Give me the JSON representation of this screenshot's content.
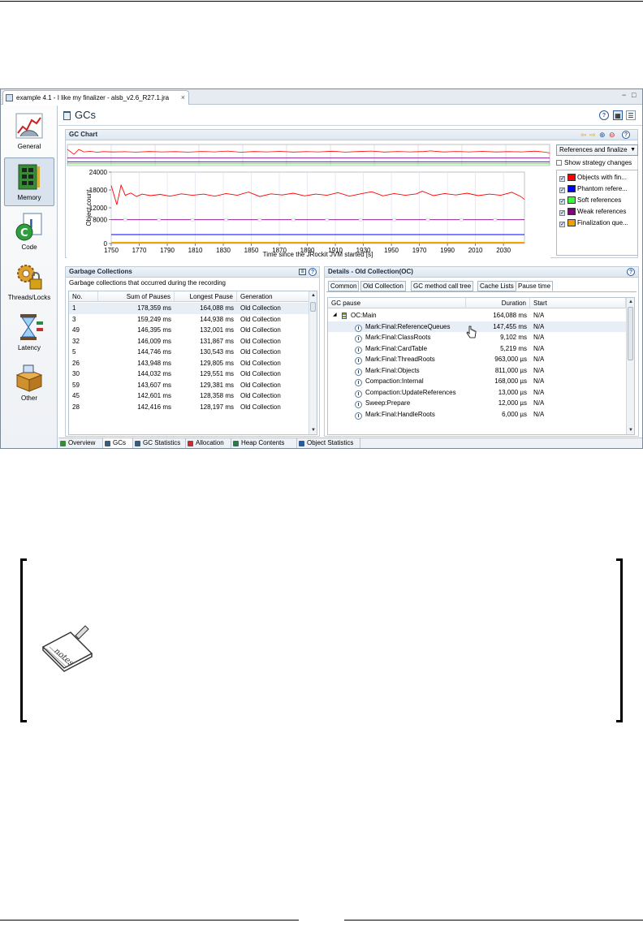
{
  "window": {
    "tab_title": "example 4.1 - I like my finalizer - alsb_v2.6_R27.1.jra",
    "close_glyph": "×",
    "minimize_glyph": "−",
    "maximize_glyph": "□"
  },
  "nav": {
    "items": [
      {
        "label": "General"
      },
      {
        "label": "Memory"
      },
      {
        "label": "Code"
      },
      {
        "label": "Threads/Locks"
      },
      {
        "label": "Latency"
      },
      {
        "label": "Other"
      }
    ],
    "active": "Memory"
  },
  "page": {
    "title": "GCs"
  },
  "gc_chart": {
    "header": "GC Chart",
    "dropdown_value": "References and finalize",
    "show_strategy_label": "Show strategy changes",
    "legend": [
      {
        "label": "Objects with fin...",
        "color": "#ff0000",
        "checked": true
      },
      {
        "label": "Phantom refere...",
        "color": "#0000ff",
        "checked": true
      },
      {
        "label": "Soft references",
        "color": "#33ff33",
        "checked": true
      },
      {
        "label": "Weak references",
        "color": "#800080",
        "checked": true
      },
      {
        "label": "Finalization que...",
        "color": "#f0a000",
        "checked": true
      }
    ]
  },
  "chart_data": {
    "type": "line",
    "ylabel": "Object count",
    "xlabel": "Time since the JRockit JVM started [s]",
    "ylim": [
      0,
      24000
    ],
    "xlim": [
      1750,
      2045
    ],
    "yticks": [
      "24000",
      "18000",
      "12000",
      "8000",
      "0"
    ],
    "xticks": [
      "1750",
      "1770",
      "1790",
      "1810",
      "1830",
      "1850",
      "1870",
      "1890",
      "1910",
      "1930",
      "1950",
      "1970",
      "1990",
      "2010",
      "2030"
    ],
    "series": [
      {
        "name": "Objects with fin...",
        "color": "#ff0000",
        "x": [
          1750,
          1754,
          1757,
          1760,
          1764,
          1768,
          1772,
          1778,
          1785,
          1792,
          1800,
          1808,
          1816,
          1824,
          1832,
          1840,
          1848,
          1856,
          1864,
          1872,
          1880,
          1888,
          1896,
          1904,
          1912,
          1920,
          1928,
          1936,
          1944,
          1952,
          1960,
          1968,
          1972,
          1980,
          1988,
          1996,
          2004,
          2012,
          2020,
          2028,
          2036,
          2042,
          2045
        ],
        "values": [
          19500,
          13000,
          19600,
          16200,
          17000,
          15800,
          16600,
          16100,
          16500,
          15900,
          16700,
          16200,
          16600,
          15900,
          16800,
          16200,
          17300,
          15800,
          16700,
          16300,
          16900,
          16000,
          16600,
          16200,
          17100,
          15900,
          16700,
          17400,
          16000,
          16800,
          16200,
          16700,
          17600,
          16100,
          16800,
          16300,
          16900,
          16100,
          16600,
          16200,
          17200,
          15900,
          14800
        ]
      },
      {
        "name": "Phantom refere...",
        "color": "#0000ff",
        "x": [
          1750,
          2045
        ],
        "values": [
          3000,
          3000
        ]
      },
      {
        "name": "Soft references",
        "color": "#33ff33",
        "x": [
          1750,
          2045
        ],
        "values": [
          150,
          150
        ]
      },
      {
        "name": "Weak references",
        "color": "#800080",
        "x": [
          1750,
          2045
        ],
        "values": [
          8000,
          8000
        ]
      },
      {
        "name": "Finalization que...",
        "color": "#f0a000",
        "x": [
          1750,
          2045
        ],
        "values": [
          400,
          400
        ]
      }
    ]
  },
  "garbage_collections": {
    "header": "Garbage Collections",
    "description": "Garbage collections that occurred during the recording",
    "columns": [
      "No.",
      "Sum of Pauses",
      "Longest Pause",
      "Generation"
    ],
    "rows": [
      [
        "1",
        "178,359 ms",
        "164,088 ms",
        "Old Collection"
      ],
      [
        "3",
        "159,249 ms",
        "144,938 ms",
        "Old Collection"
      ],
      [
        "49",
        "146,395 ms",
        "132,001 ms",
        "Old Collection"
      ],
      [
        "32",
        "146,009 ms",
        "131,867 ms",
        "Old Collection"
      ],
      [
        "5",
        "144,746 ms",
        "130,543 ms",
        "Old Collection"
      ],
      [
        "26",
        "143,948 ms",
        "129,805 ms",
        "Old Collection"
      ],
      [
        "30",
        "144,032 ms",
        "129,551 ms",
        "Old Collection"
      ],
      [
        "59",
        "143,607 ms",
        "129,381 ms",
        "Old Collection"
      ],
      [
        "45",
        "142,601 ms",
        "128,358 ms",
        "Old Collection"
      ],
      [
        "28",
        "142,416 ms",
        "128,197 ms",
        "Old Collection"
      ]
    ]
  },
  "details": {
    "header": "Details - Old Collection(OC)",
    "tabs": [
      "Common",
      "Old Collection",
      "GC method call tree",
      "Cache Lists",
      "Pause time"
    ],
    "active_tab": "Pause time",
    "columns": [
      "GC pause",
      "Duration",
      "Start"
    ],
    "tree_expander": "◢",
    "root": {
      "name": "OC:Main",
      "duration": "164,088 ms",
      "start": "N/A"
    },
    "children": [
      {
        "name": "Mark:Final:ReferenceQueues",
        "duration": "147,455 ms",
        "start": "N/A"
      },
      {
        "name": "Mark:Final:ClassRoots",
        "duration": "9,102 ms",
        "start": "N/A"
      },
      {
        "name": "Mark:Final:CardTable",
        "duration": "5,219 ms",
        "start": "N/A"
      },
      {
        "name": "Mark:Final:ThreadRoots",
        "duration": "963,000 µs",
        "start": "N/A"
      },
      {
        "name": "Mark:Final:Objects",
        "duration": "811,000 µs",
        "start": "N/A"
      },
      {
        "name": "Compaction:Internal",
        "duration": "168,000 µs",
        "start": "N/A"
      },
      {
        "name": "Compaction:UpdateReferences",
        "duration": "13,000 µs",
        "start": "N/A"
      },
      {
        "name": "Sweep:Prepare",
        "duration": "12,000 µs",
        "start": "N/A"
      },
      {
        "name": "Mark:Final:HandleRoots",
        "duration": "6,000 µs",
        "start": "N/A"
      }
    ]
  },
  "bottom_tabs": [
    "Overview",
    "GCs",
    "GC Statistics",
    "Allocation",
    "Heap Contents",
    "Object Statistics"
  ],
  "bottom_active": "GCs"
}
